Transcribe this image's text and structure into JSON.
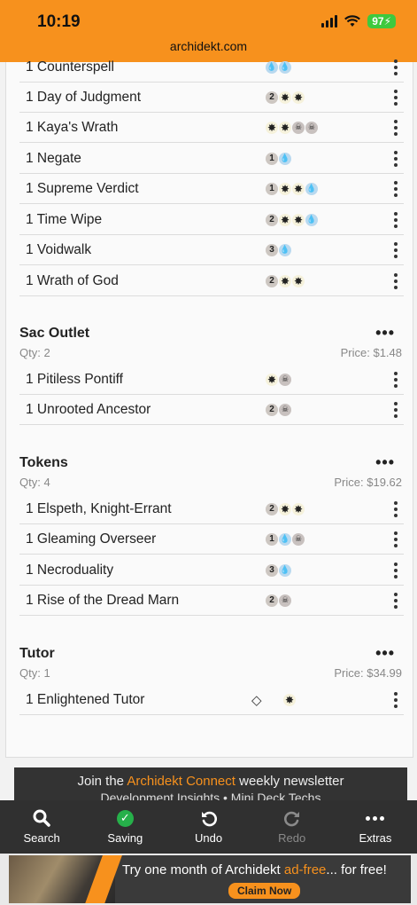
{
  "status": {
    "time": "10:19",
    "battery": "97",
    "url": "archidekt.com"
  },
  "sections": [
    {
      "id": "control",
      "cards": [
        {
          "name": "1 Counterspell",
          "mana": [
            "U",
            "U"
          ]
        },
        {
          "name": "1 Day of Judgment",
          "mana": [
            "2",
            "W",
            "W"
          ]
        },
        {
          "name": "1 Kaya's Wrath",
          "mana": [
            "W",
            "W",
            "B",
            "B"
          ]
        },
        {
          "name": "1 Negate",
          "mana": [
            "1",
            "U"
          ]
        },
        {
          "name": "1 Supreme Verdict",
          "mana": [
            "1",
            "W",
            "W",
            "U"
          ]
        },
        {
          "name": "1 Time Wipe",
          "mana": [
            "2",
            "W",
            "W",
            "U"
          ]
        },
        {
          "name": "1 Voidwalk",
          "mana": [
            "3",
            "U"
          ]
        },
        {
          "name": "1 Wrath of God",
          "mana": [
            "2",
            "W",
            "W"
          ]
        }
      ]
    },
    {
      "id": "sac",
      "title": "Sac Outlet",
      "qty": "Qty: 2",
      "price": "Price: $1.48",
      "cards": [
        {
          "name": "1 Pitiless Pontiff",
          "mana": [
            "W",
            "B"
          ]
        },
        {
          "name": "1 Unrooted Ancestor",
          "mana": [
            "2",
            "B"
          ]
        }
      ]
    },
    {
      "id": "tokens",
      "title": "Tokens",
      "qty": "Qty: 4",
      "price": "Price: $19.62",
      "cards": [
        {
          "name": "1 Elspeth, Knight-Errant",
          "mana": [
            "2",
            "W",
            "W"
          ]
        },
        {
          "name": "1 Gleaming Overseer",
          "mana": [
            "1",
            "U",
            "B"
          ]
        },
        {
          "name": "1 Necroduality",
          "mana": [
            "3",
            "U"
          ]
        },
        {
          "name": "1 Rise of the Dread Marn",
          "mana": [
            "2",
            "B"
          ]
        }
      ]
    },
    {
      "id": "tutor",
      "title": "Tutor",
      "qty": "Qty: 1",
      "price": "Price: $34.99",
      "cards": [
        {
          "name": "1 Enlightened Tutor",
          "mana": [
            "W"
          ],
          "icon": "gem-icon"
        }
      ]
    }
  ],
  "section_more_label": "•••",
  "newsletter": {
    "pre": "Join the ",
    "highlight": "Archidekt Connect",
    "post": " weekly newsletter",
    "sub": "Development Insights • Mini Deck Techs"
  },
  "toolbar": [
    {
      "id": "search",
      "label": "Search",
      "icon": "search-icon",
      "enabled": true
    },
    {
      "id": "saving",
      "label": "Saving",
      "icon": "check-icon",
      "enabled": true
    },
    {
      "id": "undo",
      "label": "Undo",
      "icon": "undo-icon",
      "enabled": true
    },
    {
      "id": "redo",
      "label": "Redo",
      "icon": "redo-icon",
      "enabled": false
    },
    {
      "id": "extras",
      "label": "Extras",
      "icon": "more-icon",
      "enabled": true
    }
  ],
  "ad": {
    "pre": "Try one month of Archidekt ",
    "highlight": "ad-free",
    "post": "... for free!",
    "button": "Claim Now"
  },
  "colors": {
    "accent": "#f7911d",
    "toolbar": "#303030",
    "saving": "#26b04a"
  }
}
